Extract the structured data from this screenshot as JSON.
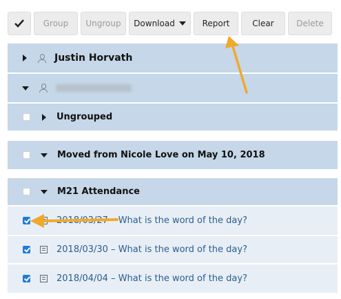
{
  "toolbar": {
    "check_icon": "checkmark-icon",
    "group": "Group",
    "ungroup": "Ungroup",
    "download": "Download",
    "report": "Report",
    "clear": "Clear",
    "delete": "Delete"
  },
  "users": [
    {
      "name": "Justin Horvath",
      "expanded": false
    },
    {
      "name": "",
      "expanded": true,
      "blurred": true
    }
  ],
  "groups": [
    {
      "label": "Ungrouped",
      "expanded": false,
      "checked": false
    },
    {
      "label": "Moved from Nicole Love on May 10, 2018",
      "expanded": true,
      "checked": false
    },
    {
      "label": "M21 Attendance",
      "expanded": true,
      "checked": false
    }
  ],
  "items": [
    {
      "label": "2018/03/27 – What is the word of the day?",
      "checked": true
    },
    {
      "label": "2018/03/30 – What is the word of the day?",
      "checked": true
    },
    {
      "label": "2018/04/04 – What is the word of the day?",
      "checked": true
    }
  ],
  "colors": {
    "header_bg": "#c5d7e8",
    "item_bg": "#e8eef5",
    "checkbox_blue": "#1f7bd6",
    "arrow": "#f0a92c",
    "link": "#2a5d8f"
  }
}
